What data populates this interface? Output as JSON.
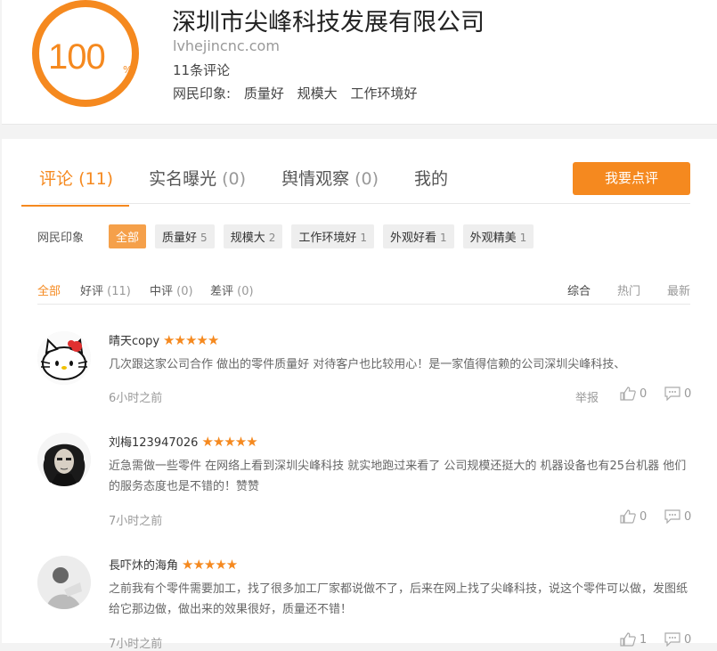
{
  "header": {
    "score": "100",
    "score_unit": "%",
    "company": "深圳市尖峰科技发展有限公司",
    "domain": "lvhejincnc.com",
    "review_count": "11条评论",
    "impressions_label": "网民印象:",
    "impressions": [
      "质量好",
      "规模大",
      "工作环境好"
    ]
  },
  "tabs": [
    {
      "label": "评论",
      "count": "(11)"
    },
    {
      "label": "实名曝光",
      "count": "(0)"
    },
    {
      "label": "舆情观察",
      "count": "(0)"
    },
    {
      "label": "我的",
      "count": ""
    }
  ],
  "review_button": "我要点评",
  "tags": {
    "label": "网民印象",
    "items": [
      {
        "text": "全部",
        "n": ""
      },
      {
        "text": "质量好",
        "n": "5"
      },
      {
        "text": "规模大",
        "n": "2"
      },
      {
        "text": "工作环境好",
        "n": "1"
      },
      {
        "text": "外观好看",
        "n": "1"
      },
      {
        "text": "外观精美",
        "n": "1"
      }
    ]
  },
  "filters": [
    {
      "text": "全部",
      "n": ""
    },
    {
      "text": "好评",
      "n": "(11)"
    },
    {
      "text": "中评",
      "n": "(0)"
    },
    {
      "text": "差评",
      "n": "(0)"
    }
  ],
  "sorts": [
    "综合",
    "热门",
    "最新"
  ],
  "reviews": [
    {
      "name": "晴天copy",
      "stars": "★★★★★",
      "text": "几次跟这家公司合作 做出的零件质量好 对待客户也比较用心！是一家值得信赖的公司深圳尖峰科技、",
      "time": "6小时之前",
      "report": "举报",
      "likes": "0",
      "comments": "0"
    },
    {
      "name": "刘梅123947026",
      "stars": "★★★★★",
      "text": "近急需做一些零件 在网络上看到深圳尖峰科技 就实地跑过来看了 公司规模还挺大的 机器设备也有25台机器 他们的服务态度也是不错的！赞赞",
      "time": "7小时之前",
      "likes": "0",
      "comments": "0"
    },
    {
      "name": "長吓炑的海角",
      "stars": "★★★★★",
      "text": "之前我有个零件需要加工，找了很多加工厂家都说做不了，后来在网上找了尖峰科技，说这个零件可以做，发图纸给它那边做，做出来的效果很好，质量还不错！",
      "time": "7小时之前",
      "likes": "1",
      "comments": "0"
    }
  ],
  "colors": {
    "accent": "#f5891f"
  }
}
